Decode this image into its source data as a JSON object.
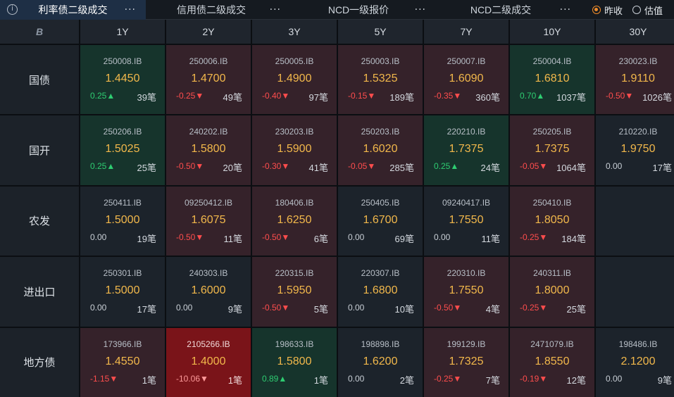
{
  "tabs": [
    {
      "label": "利率债二级成交",
      "active": true,
      "icon": "info-icon"
    },
    {
      "label": "信用债二级成交",
      "active": false
    },
    {
      "label": "NCD一级报价",
      "active": false
    },
    {
      "label": "NCD二级成交",
      "active": false
    }
  ],
  "more_glyph": "···",
  "radio_options": [
    {
      "label": "昨收",
      "checked": true
    },
    {
      "label": "估值",
      "checked": false
    }
  ],
  "corner_logo": "B",
  "columns": [
    "1Y",
    "2Y",
    "3Y",
    "5Y",
    "7Y",
    "10Y",
    "30Y"
  ],
  "rows": [
    {
      "label": "国债",
      "cells": [
        {
          "code": "250008.IB",
          "price": "1.4450",
          "change": "0.25▲",
          "count": "39笔",
          "state": "up"
        },
        {
          "code": "250006.IB",
          "price": "1.4700",
          "change": "-0.25▼",
          "count": "49笔",
          "state": "down"
        },
        {
          "code": "250005.IB",
          "price": "1.4900",
          "change": "-0.40▼",
          "count": "97笔",
          "state": "down"
        },
        {
          "code": "250003.IB",
          "price": "1.5325",
          "change": "-0.15▼",
          "count": "189笔",
          "state": "down"
        },
        {
          "code": "250007.IB",
          "price": "1.6090",
          "change": "-0.35▼",
          "count": "360笔",
          "state": "down"
        },
        {
          "code": "250004.IB",
          "price": "1.6810",
          "change": "0.70▲",
          "count": "1037笔",
          "state": "up"
        },
        {
          "code": "230023.IB",
          "price": "1.9110",
          "change": "-0.50▼",
          "count": "1026笔",
          "state": "down"
        }
      ]
    },
    {
      "label": "国开",
      "cells": [
        {
          "code": "250206.IB",
          "price": "1.5025",
          "change": "0.25▲",
          "count": "25笔",
          "state": "up"
        },
        {
          "code": "240202.IB",
          "price": "1.5800",
          "change": "-0.50▼",
          "count": "20笔",
          "state": "down"
        },
        {
          "code": "230203.IB",
          "price": "1.5900",
          "change": "-0.30▼",
          "count": "41笔",
          "state": "down"
        },
        {
          "code": "250203.IB",
          "price": "1.6020",
          "change": "-0.05▼",
          "count": "285笔",
          "state": "down"
        },
        {
          "code": "220210.IB",
          "price": "1.7375",
          "change": "0.25▲",
          "count": "24笔",
          "state": "up"
        },
        {
          "code": "250205.IB",
          "price": "1.7375",
          "change": "-0.05▼",
          "count": "1064笔",
          "state": "down"
        },
        {
          "code": "210220.IB",
          "price": "1.9750",
          "change": "0.00",
          "count": "17笔",
          "state": "flat"
        }
      ]
    },
    {
      "label": "农发",
      "cells": [
        {
          "code": "250411.IB",
          "price": "1.5000",
          "change": "0.00",
          "count": "19笔",
          "state": "flat"
        },
        {
          "code": "09250412.IB",
          "price": "1.6075",
          "change": "-0.50▼",
          "count": "11笔",
          "state": "down"
        },
        {
          "code": "180406.IB",
          "price": "1.6250",
          "change": "-0.50▼",
          "count": "6笔",
          "state": "down"
        },
        {
          "code": "250405.IB",
          "price": "1.6700",
          "change": "0.00",
          "count": "69笔",
          "state": "flat"
        },
        {
          "code": "09240417.IB",
          "price": "1.7550",
          "change": "0.00",
          "count": "11笔",
          "state": "flat"
        },
        {
          "code": "250410.IB",
          "price": "1.8050",
          "change": "-0.25▼",
          "count": "184笔",
          "state": "down"
        },
        null
      ]
    },
    {
      "label": "进出口",
      "cells": [
        {
          "code": "250301.IB",
          "price": "1.5000",
          "change": "0.00",
          "count": "17笔",
          "state": "flat"
        },
        {
          "code": "240303.IB",
          "price": "1.6000",
          "change": "0.00",
          "count": "9笔",
          "state": "flat"
        },
        {
          "code": "220315.IB",
          "price": "1.5950",
          "change": "-0.50▼",
          "count": "5笔",
          "state": "down"
        },
        {
          "code": "220307.IB",
          "price": "1.6800",
          "change": "0.00",
          "count": "10笔",
          "state": "flat"
        },
        {
          "code": "220310.IB",
          "price": "1.7550",
          "change": "-0.50▼",
          "count": "4笔",
          "state": "down"
        },
        {
          "code": "240311.IB",
          "price": "1.8000",
          "change": "-0.25▼",
          "count": "25笔",
          "state": "down"
        },
        null
      ]
    },
    {
      "label": "地方债",
      "cells": [
        {
          "code": "173966.IB",
          "price": "1.4550",
          "change": "-1.15▼",
          "count": "1笔",
          "state": "down"
        },
        {
          "code": "2105266.IB",
          "price": "1.4000",
          "change": "-10.06▼",
          "count": "1笔",
          "state": "strong-down"
        },
        {
          "code": "198633.IB",
          "price": "1.5800",
          "change": "0.89▲",
          "count": "1笔",
          "state": "up"
        },
        {
          "code": "198898.IB",
          "price": "1.6200",
          "change": "0.00",
          "count": "2笔",
          "state": "flat"
        },
        {
          "code": "199129.IB",
          "price": "1.7325",
          "change": "-0.25▼",
          "count": "7笔",
          "state": "down"
        },
        {
          "code": "2471079.IB",
          "price": "1.8550",
          "change": "-0.19▼",
          "count": "12笔",
          "state": "down"
        },
        {
          "code": "198486.IB",
          "price": "2.1200",
          "change": "0.00",
          "count": "9笔",
          "state": "flat"
        }
      ]
    }
  ],
  "colors": {
    "positive": "#2ecc71",
    "negative": "#ff4d4d",
    "price": "#f2b84b",
    "active_tab": "#1e2f45",
    "radio_checked": "#f08c2a"
  }
}
